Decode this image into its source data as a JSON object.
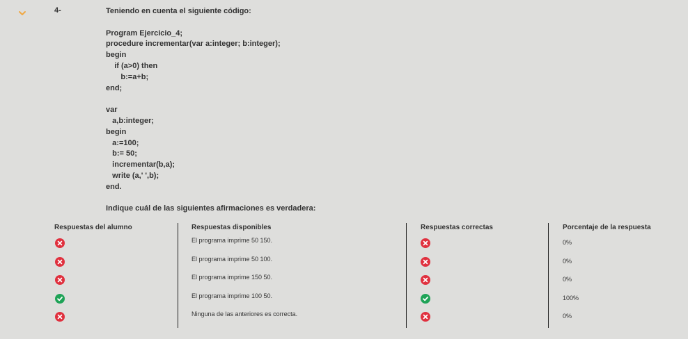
{
  "question": {
    "number": "4-",
    "intro": "Teniendo en cuenta el siguiente código:",
    "code_block_1": [
      "Program Ejercicio_4;",
      "procedure incrementar(var a:integer; b:integer);",
      "begin",
      "    if (a>0) then",
      "       b:=a+b;",
      "end;"
    ],
    "code_block_2": [
      "var",
      "   a,b:integer;",
      "begin",
      "   a:=100;",
      "   b:= 50;",
      "   incrementar(b,a);",
      "   write (a,' ',b);",
      "end."
    ],
    "prompt": "Indique cuál de las siguientes afirmaciones es verdadera:"
  },
  "table": {
    "headers": {
      "student": "Respuestas del alumno",
      "available": "Respuestas disponibles",
      "correct": "Respuestas correctas",
      "percentage": "Porcentaje de la respuesta"
    },
    "rows": [
      {
        "student": "incorrect",
        "answer": "El programa imprime 50 150.",
        "correct": "incorrect",
        "percentage": "0%"
      },
      {
        "student": "incorrect",
        "answer": "El programa imprime 50 100.",
        "correct": "incorrect",
        "percentage": "0%"
      },
      {
        "student": "incorrect",
        "answer": "El programa imprime 150 50.",
        "correct": "incorrect",
        "percentage": "0%"
      },
      {
        "student": "correct",
        "answer": "El programa imprime 100 50.",
        "correct": "correct",
        "percentage": "100%"
      },
      {
        "student": "incorrect",
        "answer": "Ninguna de las anteriores es correcta.",
        "correct": "incorrect",
        "percentage": "0%"
      }
    ]
  },
  "icons": {
    "collapse": "chevron-down-icon",
    "incorrect": "x-circle-icon",
    "correct": "check-circle-icon"
  },
  "colors": {
    "background": "#dededc",
    "chevron": "#f0a945",
    "incorrect": "#e0303e",
    "correct": "#1fa357",
    "text": "#333333"
  }
}
